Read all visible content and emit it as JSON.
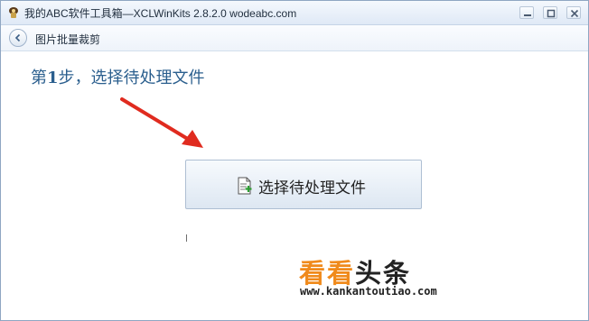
{
  "window": {
    "title": "我的ABC软件工具箱—XCLWinKits 2.8.2.0  wodeabc.com"
  },
  "subbar": {
    "title": "图片批量裁剪"
  },
  "main": {
    "step_prefix": "第",
    "step_number": "1",
    "step_suffix": "步，选择待处理文件",
    "select_button_label": "选择待处理文件"
  },
  "watermark": {
    "part1": "看看",
    "part2": "头条",
    "url": "www.kankantoutiao.com"
  },
  "colors": {
    "step_title": "#2b5f8e",
    "arrow": "#e02b1f",
    "watermark_orange": "#f08a1b"
  },
  "icons": [
    "app-icon",
    "minimize-icon",
    "maximize-icon",
    "close-icon",
    "back-arrow-icon",
    "file-add-icon",
    "pointer-arrow"
  ]
}
